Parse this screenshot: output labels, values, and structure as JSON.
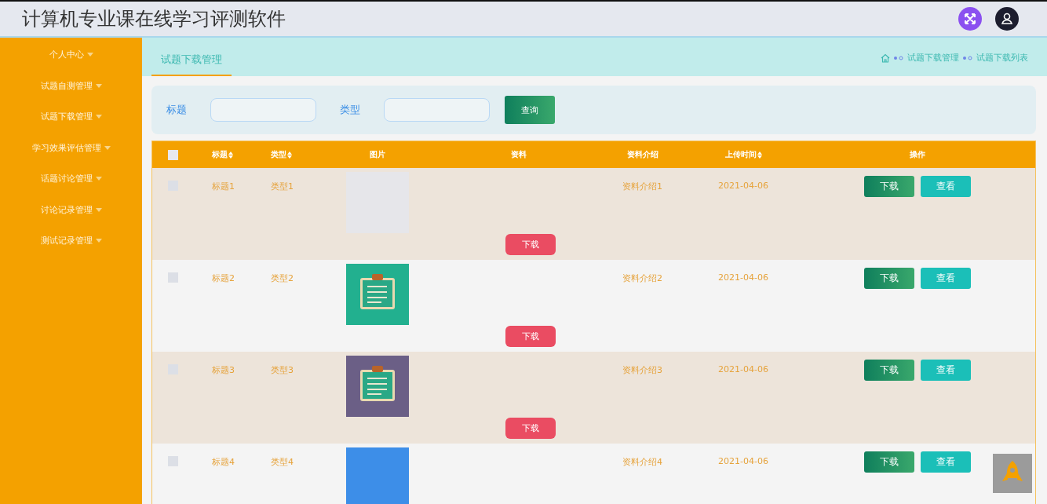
{
  "header": {
    "title": "计算机专业课在线学习评测软件"
  },
  "sidebar": {
    "items": [
      {
        "label": "个人中心"
      },
      {
        "label": "试题自测管理"
      },
      {
        "label": "试题下载管理"
      },
      {
        "label": "学习效果评估管理"
      },
      {
        "label": "话题讨论管理"
      },
      {
        "label": "讨论记录管理"
      },
      {
        "label": "测试记录管理"
      }
    ]
  },
  "tabs": [
    {
      "label": "试题下载管理",
      "selected": true
    }
  ],
  "breadcrumb": [
    "试题下载管理",
    "试题下载列表"
  ],
  "search": {
    "fields": [
      {
        "label": "标题"
      },
      {
        "label": "类型"
      }
    ],
    "button": "查询"
  },
  "table": {
    "select_all": {
      "checked": false
    },
    "columns": [
      {
        "label": "标题",
        "sortable": true
      },
      {
        "label": "类型",
        "sortable": true
      },
      {
        "label": "图片",
        "sortable": false
      },
      {
        "label": "资料",
        "sortable": false
      },
      {
        "label": "资料介绍",
        "sortable": false
      },
      {
        "label": "上传时间",
        "sortable": true
      },
      {
        "label": "操作",
        "sortable": false
      }
    ],
    "rows": [
      {
        "checked": false,
        "title": "标题1",
        "type": "类型1",
        "image": {
          "kind": "photo",
          "color": "#e6e6ea"
        },
        "file_button": "下载",
        "intro": "资料介绍1",
        "time": "2021-04-06",
        "actions": [
          "下载",
          "查看"
        ]
      },
      {
        "checked": false,
        "title": "标题2",
        "type": "类型2",
        "image": {
          "kind": "clipboard",
          "color": "#22b08f"
        },
        "file_button": "下载",
        "intro": "资料介绍2",
        "time": "2021-04-06",
        "actions": [
          "下载",
          "查看"
        ]
      },
      {
        "checked": false,
        "title": "标题3",
        "type": "类型3",
        "image": {
          "kind": "clipboard",
          "color": "#6b5f86"
        },
        "file_button": "下载",
        "intro": "资料介绍3",
        "time": "2021-04-06",
        "actions": [
          "下载",
          "查看"
        ]
      },
      {
        "checked": false,
        "title": "标题4",
        "type": "类型4",
        "image": {
          "kind": "photo",
          "color": "#3d8ee8"
        },
        "intro": "资料介绍4",
        "time": "2021-04-06",
        "actions": [
          "下载",
          "查看"
        ]
      }
    ]
  }
}
